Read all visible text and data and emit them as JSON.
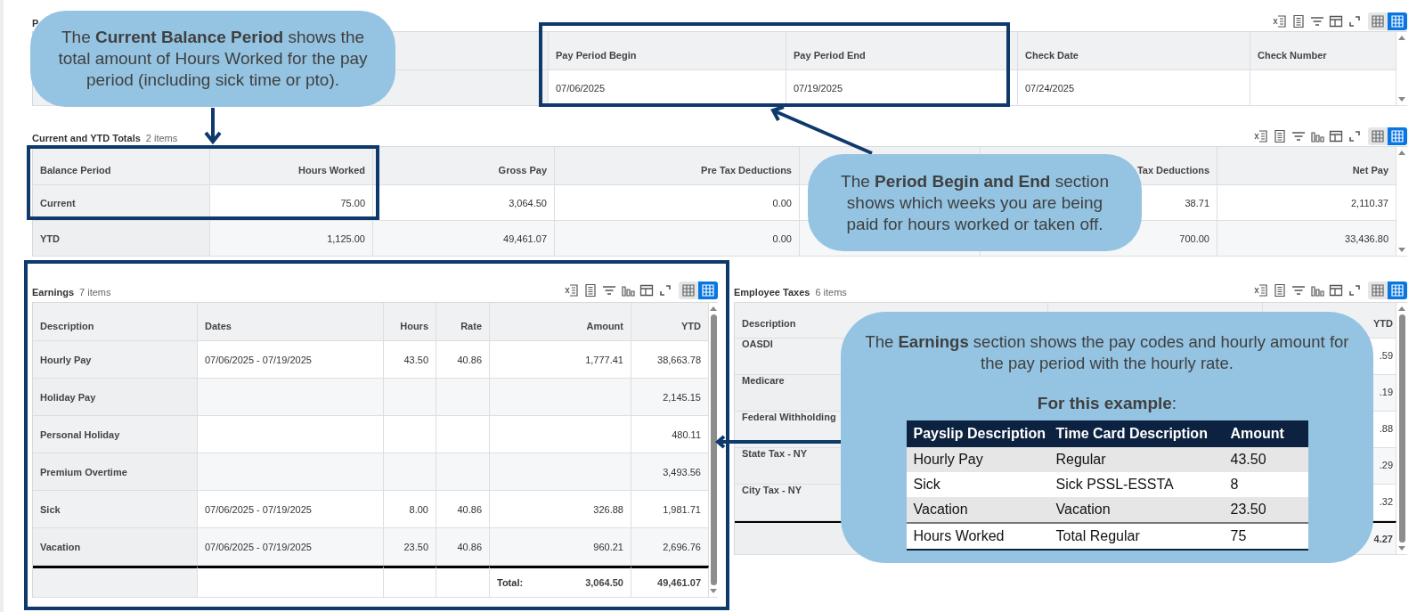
{
  "tables": [
    {
      "title": "P",
      "tools": [
        {
          "kind": "export"
        },
        {
          "kind": "view"
        },
        {
          "kind": "filter"
        },
        {
          "kind": "layout"
        },
        {
          "kind": "fullscreen"
        }
      ],
      "view_toggle": [
        {
          "selected": false
        },
        {
          "selected": true
        }
      ],
      "columns": [
        {},
        {
          "label": "Pay Period Begin"
        },
        {
          "label": "Pay Period End"
        },
        {
          "label": "Check Date"
        },
        {
          "label": "Check Number"
        }
      ],
      "rows": [
        {
          "kind": "data",
          "cells": [
            null,
            "07/06/2025",
            "07/19/2025",
            "07/24/2025",
            null
          ]
        }
      ]
    },
    {
      "title": "Current and YTD Totals",
      "count": "2 items",
      "tools": [
        {
          "kind": "export"
        },
        {
          "kind": "view"
        },
        {
          "kind": "filter"
        },
        {
          "kind": "chart"
        },
        {
          "kind": "layout"
        },
        {
          "kind": "fullscreen"
        }
      ],
      "view_toggle": [
        {
          "selected": false
        },
        {
          "selected": true
        }
      ],
      "columns": [
        {
          "label": "Balance Period"
        },
        {
          "label": "Hours Worked"
        },
        {
          "label": "Gross Pay"
        },
        {
          "label": "Pre Tax Deductions"
        },
        {},
        {
          "label": "Tax Deductions"
        },
        {
          "label": "Net Pay"
        }
      ],
      "rows": [
        {
          "kind": "data",
          "cells": [
            "Current",
            "75.00",
            "3,064.50",
            "0.00",
            null,
            "38.71",
            "2,110.37"
          ]
        },
        {
          "kind": "data",
          "cells": [
            "YTD",
            "1,125.00",
            "49,461.07",
            "0.00",
            null,
            "700.00",
            "33,436.80"
          ]
        }
      ]
    },
    {
      "title": "Earnings",
      "count": "7 items",
      "tools": [
        {
          "kind": "export"
        },
        {
          "kind": "view"
        },
        {
          "kind": "filter"
        },
        {
          "kind": "chart"
        },
        {
          "kind": "layout"
        },
        {
          "kind": "fullscreen"
        }
      ],
      "view_toggle": [
        {
          "selected": false
        },
        {
          "selected": true
        }
      ],
      "columns": [
        {
          "label": "Description"
        },
        {
          "label": "Dates"
        },
        {
          "label": "Hours"
        },
        {
          "label": "Rate"
        },
        {
          "label": "Amount"
        },
        {
          "label": "YTD"
        }
      ],
      "rows": [
        {
          "kind": "data",
          "cells": [
            "Hourly Pay",
            "07/06/2025 - 07/19/2025",
            "43.50",
            "40.86",
            "1,777.41",
            "38,663.78"
          ]
        },
        {
          "kind": "data",
          "cells": [
            "Holiday Pay",
            null,
            null,
            null,
            null,
            "2,145.15"
          ]
        },
        {
          "kind": "data",
          "cells": [
            "Personal Holiday",
            null,
            null,
            null,
            null,
            "480.11"
          ]
        },
        {
          "kind": "data",
          "cells": [
            "Premium Overtime",
            null,
            null,
            null,
            null,
            "3,493.56"
          ]
        },
        {
          "kind": "data",
          "cells": [
            "Sick",
            "07/06/2025 - 07/19/2025",
            "8.00",
            "40.86",
            "326.88",
            "1,981.71"
          ]
        },
        {
          "kind": "data",
          "cells": [
            "Vacation",
            "07/06/2025 - 07/19/2025",
            "23.50",
            "40.86",
            "960.21",
            "2,696.76"
          ]
        },
        {
          "kind": "total",
          "label": "Total:",
          "cells": [
            null,
            null,
            null,
            null,
            "3,064.50",
            "49,461.07"
          ]
        }
      ]
    },
    {
      "title": "Employee Taxes",
      "count": "6 items",
      "tools": [
        {
          "kind": "export"
        },
        {
          "kind": "view"
        },
        {
          "kind": "filter"
        },
        {
          "kind": "chart"
        },
        {
          "kind": "layout"
        },
        {
          "kind": "fullscreen"
        }
      ],
      "view_toggle": [
        {
          "selected": false
        },
        {
          "selected": true
        }
      ],
      "columns": [
        {
          "label": "Description"
        },
        {},
        {
          "label": "YTD"
        }
      ],
      "rows": [
        {
          "kind": "data",
          "cells": [
            "OASDI",
            null,
            ".59"
          ]
        },
        {
          "kind": "data",
          "cells": [
            "Medicare",
            null,
            ".19"
          ]
        },
        {
          "kind": "data",
          "cells": [
            "Federal Withholding",
            null,
            ".88"
          ]
        },
        {
          "kind": "data",
          "cells": [
            "State Tax - NY",
            null,
            ".29"
          ]
        },
        {
          "kind": "data",
          "cells": [
            "City Tax - NY",
            null,
            ".32"
          ]
        },
        {
          "kind": "total",
          "cells": [
            null,
            null,
            "4.27"
          ]
        }
      ]
    }
  ],
  "callouts": [
    {
      "text": "The **Current Balance Period** shows the total amount of Hours Worked for the pay period (including sick time or pto)."
    },
    {
      "text": "The **Period Begin and End** section shows which weeks you are being paid for hours worked or taken off."
    },
    {
      "text": "The **Earnings** section shows the pay codes and hourly amount for the pay period with the hourly rate.",
      "subheading": "**For this example**:",
      "example": {
        "columns": [
          "Payslip Description",
          "Time Card Description",
          "Amount"
        ],
        "rows": [
          {
            "kind": "data",
            "cells": [
              "Hourly Pay",
              "Regular",
              "43.50"
            ]
          },
          {
            "kind": "data",
            "cells": [
              "Sick",
              "Sick PSSL-ESSTA",
              "8"
            ]
          },
          {
            "kind": "data",
            "cells": [
              "Vacation",
              "Vacation",
              "23.50"
            ]
          },
          {
            "kind": "total",
            "cells": [
              "Hours Worked",
              "Total Regular",
              "75"
            ]
          }
        ]
      }
    }
  ]
}
